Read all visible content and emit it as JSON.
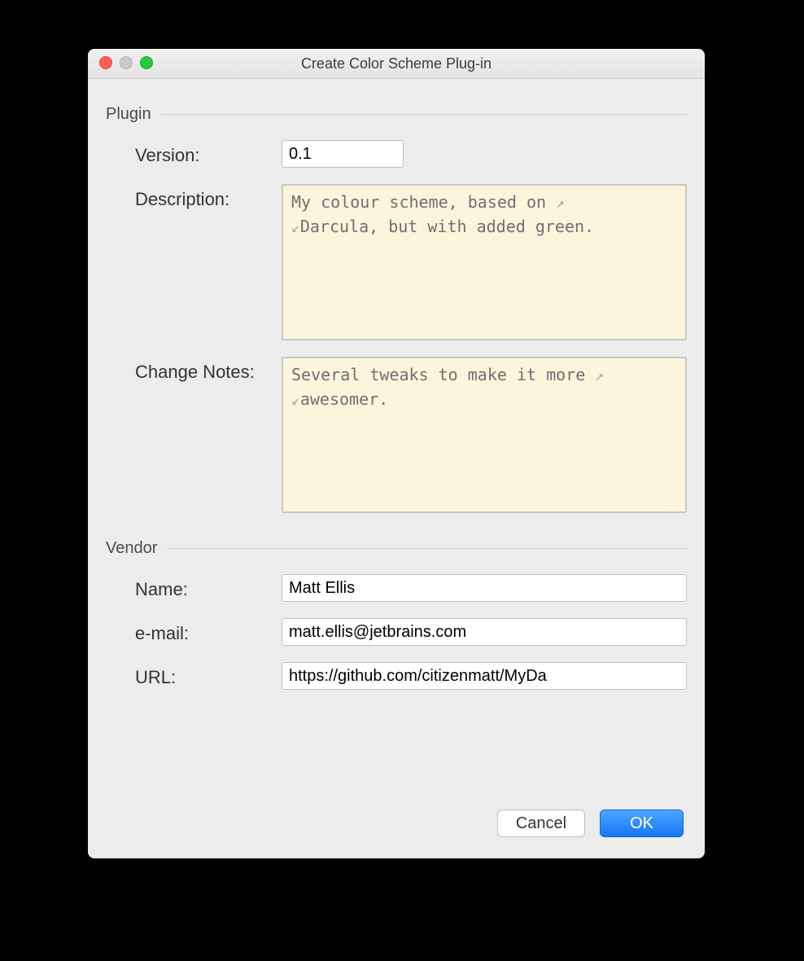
{
  "window": {
    "title": "Create Color Scheme Plug-in"
  },
  "sections": {
    "plugin": "Plugin",
    "vendor": "Vendor"
  },
  "plugin": {
    "version_label": "Version:",
    "version_value": "0.1",
    "description_label": "Description:",
    "description_text": "My colour scheme, based on Darcula, but with added green.",
    "description_line1": "My colour scheme, based on ",
    "description_line2": "Darcula, but with added green.",
    "changenotes_label": "Change Notes:",
    "changenotes_text": "Several tweaks to make it more awesomer.",
    "changenotes_line1": "Several tweaks to make it more ",
    "changenotes_line2": "awesomer."
  },
  "vendor": {
    "name_label": "Name:",
    "name_value": "Matt Ellis",
    "email_label": "e-mail:",
    "email_value": "matt.ellis@jetbrains.com",
    "url_label": "URL:",
    "url_value": "https://github.com/citizenmatt/MyDa"
  },
  "buttons": {
    "cancel": "Cancel",
    "ok": "OK"
  },
  "glyphs": {
    "soft_wrap_down": "↙",
    "soft_wrap_up": "↗"
  }
}
